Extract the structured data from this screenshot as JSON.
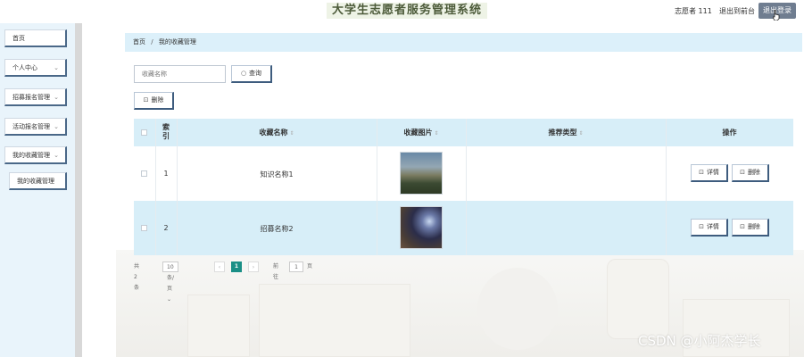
{
  "header": {
    "app_title": "大学生志愿者服务管理系统",
    "role_user": "志愿者 111",
    "back_to_front": "退出到前台",
    "logout": "退出登录"
  },
  "sidebar": {
    "items": [
      {
        "label": "首页"
      },
      {
        "label": "个人中心"
      },
      {
        "label": "招募报名管理"
      },
      {
        "label": "活动报名管理"
      },
      {
        "label": "我的收藏管理"
      },
      {
        "label": "我的收藏管理"
      }
    ]
  },
  "breadcrumb": {
    "home": "首页",
    "separator": "/",
    "current": "我的收藏管理"
  },
  "search": {
    "placeholder": "收藏名称",
    "button_label": "查询"
  },
  "toolbar": {
    "delete_label": "删除"
  },
  "table": {
    "headers": {
      "index_line1": "索",
      "index_line2": "引",
      "name": "收藏名称",
      "image": "收藏图片",
      "type": "推荐类型",
      "actions": "操作"
    },
    "rows": [
      {
        "index": "1",
        "name": "知识名称1",
        "type": "",
        "detail": "详情",
        "delete": "删除"
      },
      {
        "index": "2",
        "name": "招募名称2",
        "type": "",
        "detail": "详情",
        "delete": "删除"
      }
    ]
  },
  "pagination": {
    "total": "共 2 条",
    "page_size": "10条/页",
    "prev": "‹",
    "current_page": "1",
    "next": "›",
    "goto_label": "前往",
    "goto_value": "1",
    "page_unit": "页"
  },
  "watermark": "CSDN @小阿杰学长",
  "colors": {
    "breadcrumb_bg": "#dcf0fa",
    "table_header_bg": "#d7eef8",
    "active_page": "#1a8f86",
    "logout_bg": "#6f7d90"
  }
}
